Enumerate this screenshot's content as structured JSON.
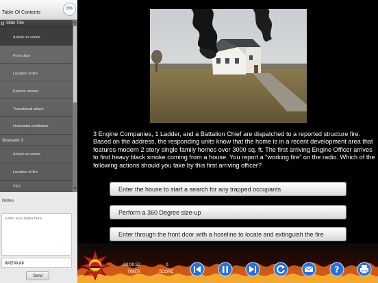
{
  "sidebar": {
    "toc_title": "Table Of Contents",
    "progress": "0%",
    "items": [
      {
        "label": "Slide Title",
        "kind": "head"
      },
      {
        "label": "Arrival on-scene",
        "kind": "active"
      },
      {
        "label": "Front door",
        "kind": "item"
      },
      {
        "label": "Location of fire",
        "kind": "item"
      },
      {
        "label": "Exterior stream",
        "kind": "item"
      },
      {
        "label": "Transitional attack",
        "kind": "item"
      },
      {
        "label": "Horizontal ventilation",
        "kind": "item"
      },
      {
        "label": "Scenario 2",
        "kind": "section"
      },
      {
        "label": "Arrival on-scene",
        "kind": "item"
      },
      {
        "label": "Location of fire",
        "kind": "item"
      },
      {
        "label": "VES",
        "kind": "item"
      }
    ],
    "notes_label": "Notes",
    "notes_placeholder": "Enter your notes here",
    "email_value": "pp@pp.pp",
    "send_label": "Send"
  },
  "main": {
    "question": "3 Engine Companies, 1 Ladder, and a Battalion Chief are dispatched to a reported structure fire. Based on the address, the responding units know that the home is in a recent development area that features modern 2 story single family homes over 3000 sq. ft.  The first arriving Engine Officer arrives to find heavy black smoke coming from a house.  You report a “working fire” on the radio. Which of the following actions should you take by this first arriving officer?",
    "answers": [
      "Enter the house to start a search for any trapped occupants",
      "Perform a 360 Degree size-up",
      "Enter through the front door with a hoseline to locate and extinguish the fire"
    ]
  },
  "bottombar": {
    "timer_value": "00:00:52",
    "timer_label": "TIMER",
    "score_value": "0",
    "score_label": "SCORE",
    "controls": [
      "previous-icon",
      "pause-icon",
      "next-icon",
      "replay-icon",
      "email-icon",
      "help-icon",
      "print-icon"
    ]
  },
  "colors": {
    "button_blue": "#2b6fd6",
    "accent": "#3a6ea5"
  }
}
